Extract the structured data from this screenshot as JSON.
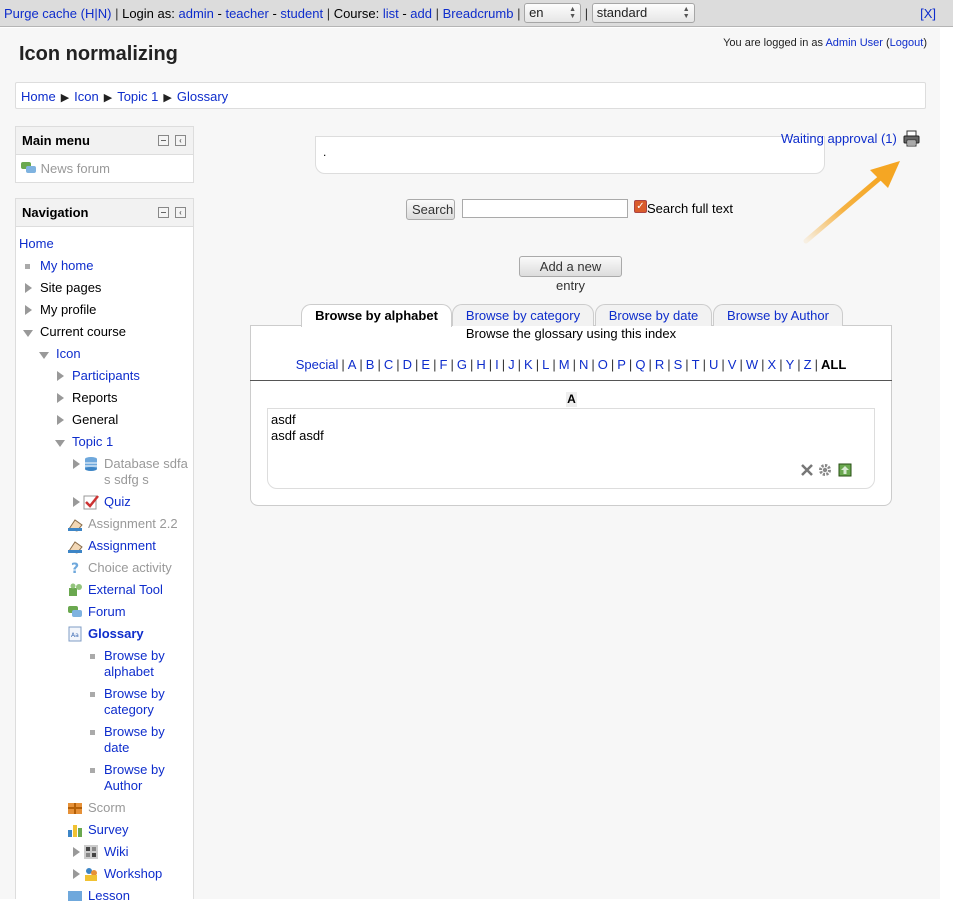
{
  "devbar": {
    "purge_cache": "Purge cache",
    "purge_h": "H",
    "purge_n": "N",
    "login_as": "Login as:",
    "admin": "admin",
    "teacher": "teacher",
    "student": "student",
    "course_label": "Course:",
    "list": "list",
    "add": "add",
    "breadcrumb": "Breadcrumb",
    "lang_value": "en",
    "theme_value": "standard",
    "close": "[X]"
  },
  "header": {
    "title": "Icon normalizing",
    "logged_in_text": "You are logged in as",
    "user_name": "Admin User",
    "logout": "Logout"
  },
  "breadcrumb": [
    "Home",
    "Icon",
    "Topic 1",
    "Glossary"
  ],
  "main_menu": {
    "title": "Main menu",
    "items": [
      "News forum"
    ]
  },
  "navigation": {
    "title": "Navigation",
    "home": "Home",
    "my_home": "My home",
    "site_pages": "Site pages",
    "my_profile": "My profile",
    "current_course": "Current course",
    "course": "Icon",
    "participants": "Participants",
    "reports": "Reports",
    "general": "General",
    "topic1": "Topic 1",
    "database_line1": "Database sdfa",
    "database_line2": "s sdfg s",
    "quiz": "Quiz",
    "assignment22": "Assignment 2.2",
    "assignment": "Assignment",
    "choice": "Choice activity",
    "external_tool": "External Tool",
    "forum": "Forum",
    "glossary": "Glossary",
    "browse_alpha_1": "Browse by",
    "browse_alpha_2": "alphabet",
    "browse_cat_1": "Browse by",
    "browse_cat_2": "category",
    "browse_date_1": "Browse by",
    "browse_date_2": "date",
    "browse_author_1": "Browse by",
    "browse_author_2": "Author",
    "scorm": "Scorm",
    "survey": "Survey",
    "wiki": "Wiki",
    "workshop": "Workshop",
    "lesson": "Lesson"
  },
  "main": {
    "intro_text": ".",
    "waiting_approval": "Waiting approval (1)",
    "search_button": "Search",
    "search_value": "",
    "search_full_text": "Search full text",
    "add_entry": "Add a new entry",
    "tabs": [
      "Browse by alphabet",
      "Browse by category",
      "Browse by date",
      "Browse by Author"
    ],
    "browse_description": "Browse the glossary using this index",
    "alphabet": [
      "Special",
      "A",
      "B",
      "C",
      "D",
      "E",
      "F",
      "G",
      "H",
      "I",
      "J",
      "K",
      "L",
      "M",
      "N",
      "O",
      "P",
      "Q",
      "R",
      "S",
      "T",
      "U",
      "V",
      "W",
      "X",
      "Y",
      "Z"
    ],
    "alphabet_all": "ALL",
    "letter_heading": "A",
    "entry": {
      "concept": "asdf",
      "definition": "asdf asdf"
    }
  },
  "colors": {
    "link": "#0e2dcc",
    "arrow": "#f5a623"
  }
}
